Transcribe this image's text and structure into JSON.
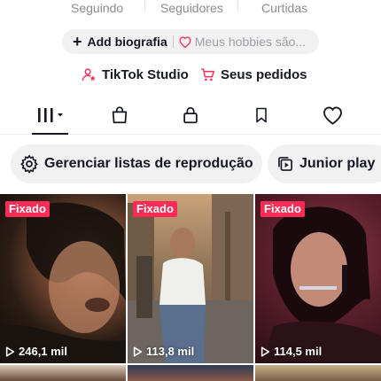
{
  "stats": {
    "following_label": "Seguindo",
    "followers_label": "Seguidores",
    "likes_label": "Curtidas"
  },
  "bio": {
    "add_label": "Add biografia",
    "hint": "Meus hobbies são..."
  },
  "links": {
    "studio_label": "TikTok Studio",
    "orders_label": "Seus pedidos"
  },
  "tabs": [
    "videos-grid-icon",
    "bag-icon",
    "lock-icon",
    "bookmark-icon",
    "heart-icon"
  ],
  "chips": {
    "playlists_label": "Gerenciar listas de reprodução",
    "junior_label": "Junior play"
  },
  "colors": {
    "accent": "#fe2c55",
    "text": "#161823",
    "muted": "#8a8b91",
    "chip_bg": "#f1f1f2"
  },
  "videos": [
    {
      "badge": "Fixado",
      "views": "246,1 mil"
    },
    {
      "badge": "Fixado",
      "views": "113,8 mil"
    },
    {
      "badge": "Fixado",
      "views": "114,5 mil"
    }
  ]
}
